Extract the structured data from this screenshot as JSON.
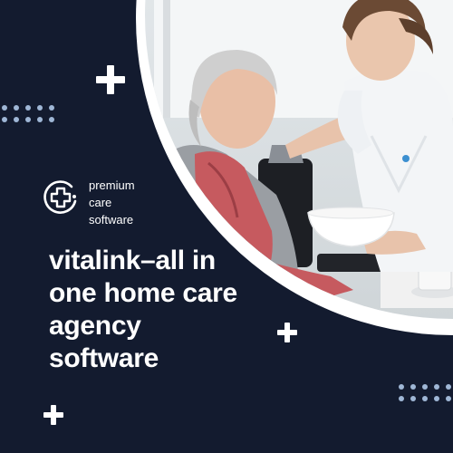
{
  "brand": {
    "logo_icon": "plus-circle-logo-icon",
    "tagline_lines": [
      "premium",
      "care",
      "software"
    ]
  },
  "headline": {
    "lines": [
      "vitalink–all in",
      "one home care",
      "agency",
      "software"
    ]
  },
  "decor": {
    "icons": [
      "plus-icon",
      "plus-icon",
      "plus-icon",
      "dot-grid",
      "dot-grid"
    ],
    "photo": "nurse-serving-elderly-woman-photo"
  },
  "colors": {
    "background": "#131b2f",
    "text": "#ffffff",
    "dots": "#9fb7d6"
  }
}
